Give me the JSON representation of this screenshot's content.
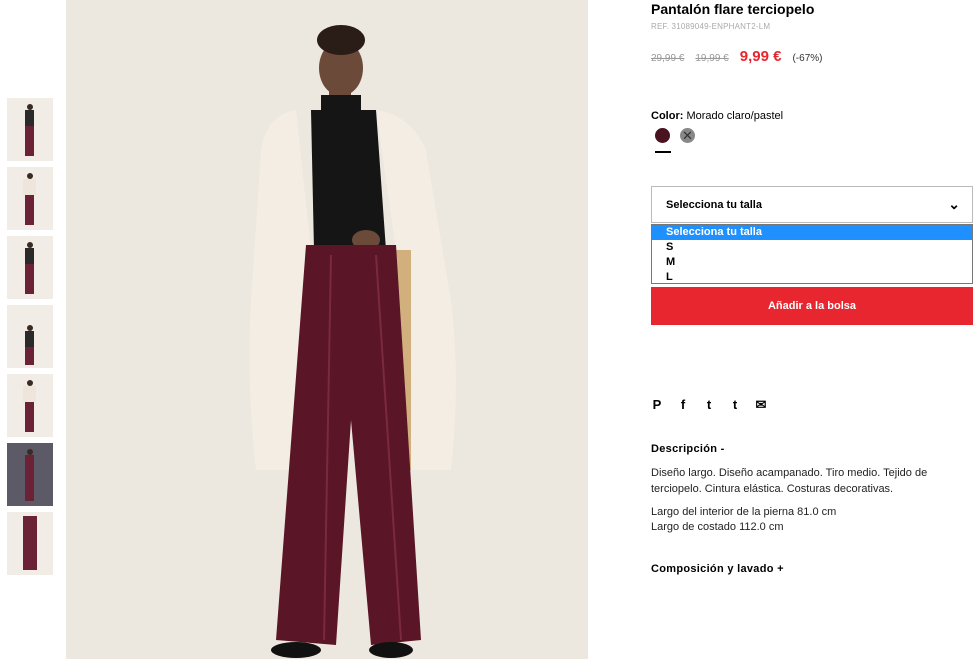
{
  "product": {
    "title": "Pantalón flare terciopelo",
    "ref": "REF. 31089049-ENPHANT2-LM",
    "price_original": "29,99 €",
    "price_previous": "19,99 €",
    "price_current": "9,99 €",
    "discount": "(-67%)"
  },
  "color": {
    "label": "Color:",
    "value": "Morado claro/pastel",
    "swatches": [
      {
        "name": "burgundy",
        "hex": "#4a1320"
      },
      {
        "name": "grey",
        "hex": "#888888"
      }
    ]
  },
  "size": {
    "placeholder": "Selecciona tu talla",
    "options": [
      "Selecciona tu talla",
      "S",
      "M",
      "L"
    ]
  },
  "actions": {
    "add_to_bag": "Añadir a la bolsa"
  },
  "social": {
    "pinterest": "P",
    "facebook": "f",
    "twitter": "t",
    "tumblr": "t",
    "email": "✉"
  },
  "description": {
    "heading": "Descripción -",
    "text": "Diseño largo. Diseño acampanado. Tiro medio. Tejido de terciopelo. Cintura elástica. Costuras decorativas.",
    "inseam": "Largo del interior de la pierna 81.0 cm",
    "side_length": "Largo de costado 112.0 cm"
  },
  "composition": {
    "heading": "Composición y lavado +"
  },
  "colors": {
    "accent": "#e8262f",
    "selected_option": "#1e90ff"
  }
}
